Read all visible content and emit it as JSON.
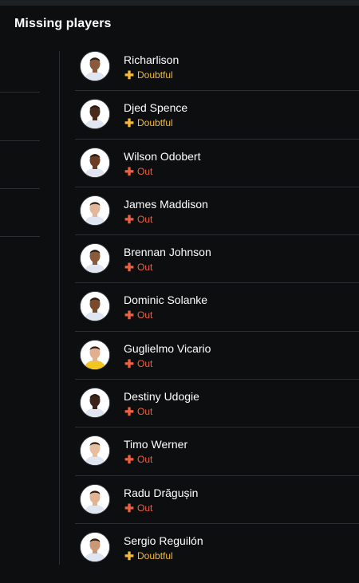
{
  "header": {
    "title": "Missing players"
  },
  "colors": {
    "background": "#0c0e0f",
    "doubtful": "#f5b938",
    "out": "#f0603f",
    "divider": "#2b2f33"
  },
  "players": [
    {
      "name": "Richarlison",
      "status": "Doubtful",
      "status_type": "doubtful",
      "kit": "#dfe6f1",
      "skin": "#8a5a3c"
    },
    {
      "name": "Djed Spence",
      "status": "Doubtful",
      "status_type": "doubtful",
      "kit": "#dfe6f1",
      "skin": "#4a2a1a"
    },
    {
      "name": "Wilson Odobert",
      "status": "Out",
      "status_type": "out",
      "kit": "#dfe6f1",
      "skin": "#6b3d24"
    },
    {
      "name": "James Maddison",
      "status": "Out",
      "status_type": "out",
      "kit": "#dfe6f1",
      "skin": "#e2b69a"
    },
    {
      "name": "Brennan Johnson",
      "status": "Out",
      "status_type": "out",
      "kit": "#dfe6f1",
      "skin": "#8a5a3c"
    },
    {
      "name": "Dominic Solanke",
      "status": "Out",
      "status_type": "out",
      "kit": "#dfe6f1",
      "skin": "#7a4a2c"
    },
    {
      "name": "Guglielmo Vicario",
      "status": "Out",
      "status_type": "out",
      "kit": "#f3c51f",
      "skin": "#e0b090"
    },
    {
      "name": "Destiny Udogie",
      "status": "Out",
      "status_type": "out",
      "kit": "#dfe6f1",
      "skin": "#3d2418"
    },
    {
      "name": "Timo Werner",
      "status": "Out",
      "status_type": "out",
      "kit": "#dfe6f1",
      "skin": "#e5bfa0"
    },
    {
      "name": "Radu Drăgușin",
      "status": "Out",
      "status_type": "out",
      "kit": "#dfe6f1",
      "skin": "#dfb393"
    },
    {
      "name": "Sergio Reguilón",
      "status": "Doubtful",
      "status_type": "doubtful",
      "kit": "#dfe6f1",
      "skin": "#c99877"
    }
  ]
}
